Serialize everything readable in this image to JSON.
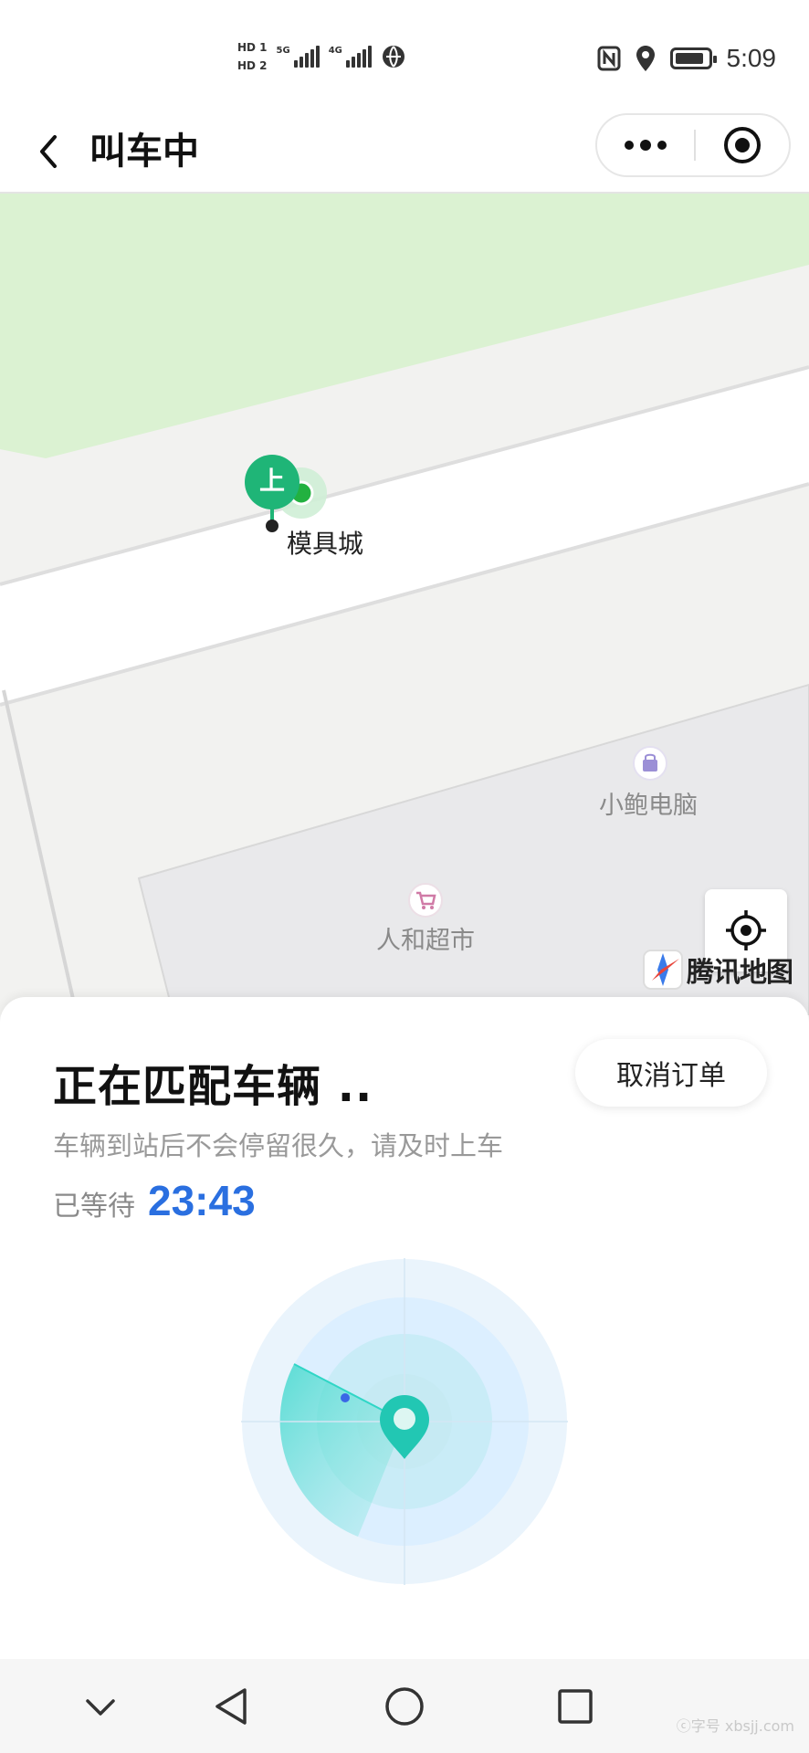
{
  "status_bar": {
    "hd1": "HD 1",
    "hd2": "HD 2",
    "sig1_label": "5G",
    "sig2_label": "4G",
    "time": "5:09",
    "icons": [
      "nfc-icon",
      "location-icon",
      "battery-icon"
    ]
  },
  "header": {
    "title": "叫车中",
    "back_icon": "chevron-left-icon",
    "more_icon": "more-dots-icon",
    "target_icon": "target-icon"
  },
  "map": {
    "pickup_marker_text": "上",
    "pickup_name": "模具城",
    "pois": [
      {
        "name": "小鲍电脑",
        "icon": "shopping-bag-icon"
      },
      {
        "name": "人和超市",
        "icon": "cart-icon"
      }
    ],
    "brand": "腾讯地图",
    "locate_icon": "locate-icon"
  },
  "sheet": {
    "title": "正在匹配车辆 ..",
    "cancel_label": "取消订单",
    "hint": "车辆到站后不会停留很久，请及时上车",
    "wait_label": "已等待",
    "wait_time": "23:43"
  },
  "colors": {
    "accent_blue": "#2a6fe0",
    "marker_green": "#1fb577",
    "radar_teal": "#2fd6c6"
  },
  "navbar": {
    "icons": [
      "chevron-down-icon",
      "back-triangle-icon",
      "home-circle-icon",
      "recents-square-icon"
    ]
  },
  "watermark": "ⓒ字号 xbsjj.com"
}
